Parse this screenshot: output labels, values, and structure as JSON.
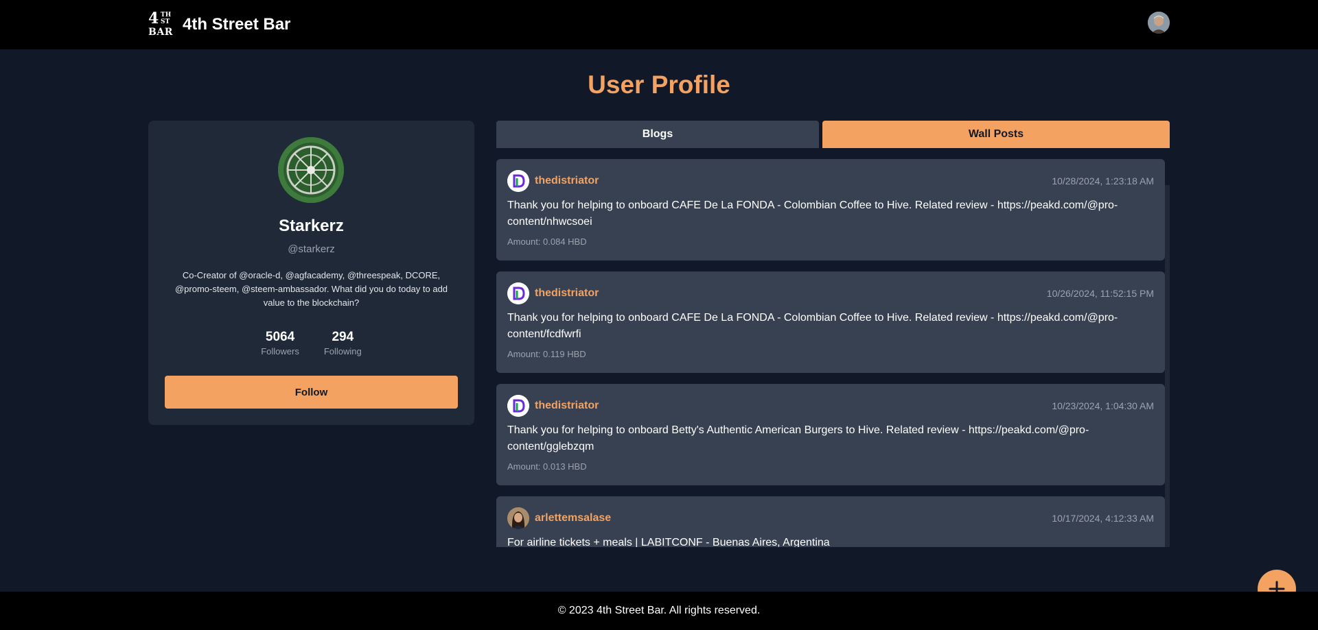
{
  "header": {
    "logo": {
      "big": "4",
      "sup": "TH",
      "sub": "ST",
      "bottom": "BAR"
    },
    "app_name": "4th Street Bar",
    "avatar_icon": "user-avatar-icon"
  },
  "page": {
    "title": "User Profile"
  },
  "profile": {
    "name": "Starkerz",
    "handle": "@starkerz",
    "bio": "Co-Creator of @oracle-d, @agfacademy, @threespeak, DCORE, @promo-steem, @steem-ambassador. What did you do today to add value to the blockchain?",
    "followers_count": "5064",
    "followers_label": "Followers",
    "following_count": "294",
    "following_label": "Following",
    "follow_label": "Follow"
  },
  "tabs": {
    "blogs": "Blogs",
    "wall_posts": "Wall Posts",
    "active": "wall_posts"
  },
  "posts": [
    {
      "author": "thedistriator",
      "date": "10/28/2024, 1:23:18 AM",
      "body": "Thank you for helping to onboard CAFE De La FONDA - Colombian Coffee to Hive. Related review - https://peakd.com/@pro-content/nhwcsoei",
      "amount": "Amount: 0.084 HBD"
    },
    {
      "author": "thedistriator",
      "date": "10/26/2024, 11:52:15 PM",
      "body": "Thank you for helping to onboard CAFE De La FONDA - Colombian Coffee to Hive. Related review - https://peakd.com/@pro-content/fcdfwrfi",
      "amount": "Amount: 0.119 HBD"
    },
    {
      "author": "thedistriator",
      "date": "10/23/2024, 1:04:30 AM",
      "body": "Thank you for helping to onboard Betty's Authentic American Burgers to Hive. Related review - https://peakd.com/@pro-content/gglebzqm",
      "amount": "Amount: 0.013 HBD"
    },
    {
      "author": "arlettemsalase",
      "date": "10/17/2024, 4:12:33 AM",
      "body": "For airline tickets + meals | LABITCONF - Buenas Aires, Argentina",
      "amount": ""
    }
  ],
  "fab": {
    "icon": "plus-icon"
  },
  "footer": {
    "copyright": "© 2023 4th Street Bar. All rights reserved."
  },
  "colors": {
    "accent": "#f4a261",
    "background": "#111827",
    "card": "#1f2937",
    "post": "#374151"
  }
}
